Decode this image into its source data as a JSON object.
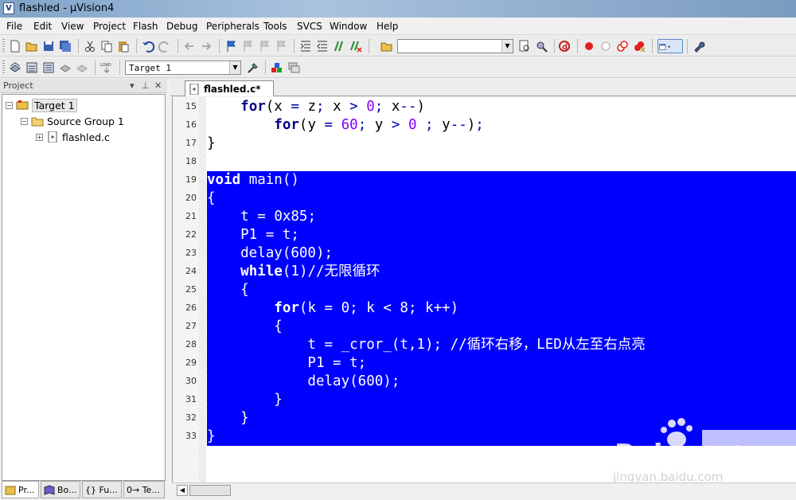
{
  "window": {
    "title": "flashled - µVision4"
  },
  "menu": [
    "File",
    "Edit",
    "View",
    "Project",
    "Flash",
    "Debug",
    "Peripherals",
    "Tools",
    "SVCS",
    "Window",
    "Help"
  ],
  "toolbar": {
    "target_combo": "Target 1",
    "find_combo": ""
  },
  "project_panel": {
    "header": "Project",
    "tree": {
      "target": "Target 1",
      "group": "Source Group 1",
      "file": "flashled.c"
    },
    "tabs": [
      "Pr...",
      "Bo...",
      "{} Fu...",
      "0→ Te..."
    ]
  },
  "editor": {
    "tab_label": "flashled.c*",
    "selection_color": "#0000ff",
    "lines": [
      {
        "n": "15",
        "text": "    for(x = z; x > 0; x--)",
        "sel": false
      },
      {
        "n": "16",
        "text": "        for(y = 60; y > 0 ; y--);",
        "sel": false
      },
      {
        "n": "17",
        "text": "}",
        "sel": false
      },
      {
        "n": "18",
        "text": "",
        "sel": false
      },
      {
        "n": "19",
        "text": "void main()",
        "sel": true
      },
      {
        "n": "20",
        "text": "{",
        "sel": true
      },
      {
        "n": "21",
        "text": "    t = 0x85;",
        "sel": true
      },
      {
        "n": "22",
        "text": "    P1 = t;",
        "sel": true
      },
      {
        "n": "23",
        "text": "    delay(600);",
        "sel": true
      },
      {
        "n": "24",
        "text": "    while(1)//无限循环",
        "sel": true
      },
      {
        "n": "25",
        "text": "    {",
        "sel": true
      },
      {
        "n": "26",
        "text": "        for(k = 0; k < 8; k++)",
        "sel": true
      },
      {
        "n": "27",
        "text": "        {",
        "sel": true
      },
      {
        "n": "28",
        "text": "            t = _cror_(t,1); //循环右移，LED从左至右点亮",
        "sel": true
      },
      {
        "n": "29",
        "text": "            P1 = t;",
        "sel": true
      },
      {
        "n": "30",
        "text": "            delay(600);",
        "sel": true
      },
      {
        "n": "31",
        "text": "        }",
        "sel": true
      },
      {
        "n": "32",
        "text": "    }",
        "sel": true
      },
      {
        "n": "33",
        "text": "}",
        "sel": true
      }
    ]
  },
  "watermark": {
    "brand": "Bai",
    "brand2": "经验",
    "url": "jingyan.baidu.com"
  }
}
